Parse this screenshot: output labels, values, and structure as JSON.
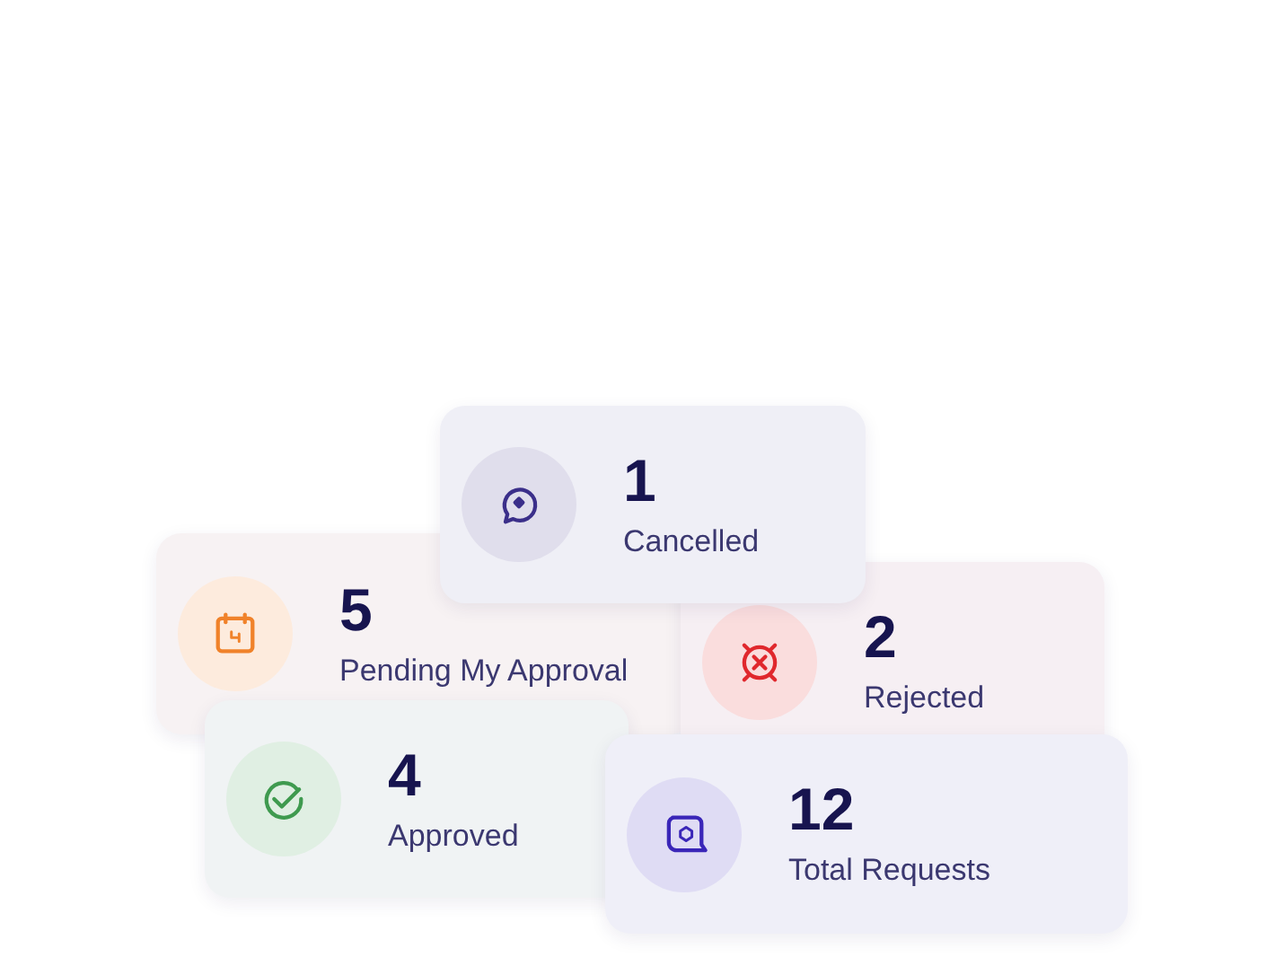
{
  "cards": [
    {
      "kind": "calendar",
      "number": "5",
      "label": "Pending My Approval",
      "color": "#f0822a"
    },
    {
      "kind": "x-circle",
      "number": "2",
      "label": "Rejected",
      "color": "#e0282d"
    },
    {
      "kind": "bubble",
      "number": "1",
      "label": "Cancelled",
      "color": "#3b2f8a"
    },
    {
      "kind": "check",
      "number": "4",
      "label": "Approved",
      "color": "#3f9a4f"
    },
    {
      "kind": "square-bubble",
      "number": "12",
      "label": "Total Requests",
      "color": "#3a26b8"
    }
  ]
}
